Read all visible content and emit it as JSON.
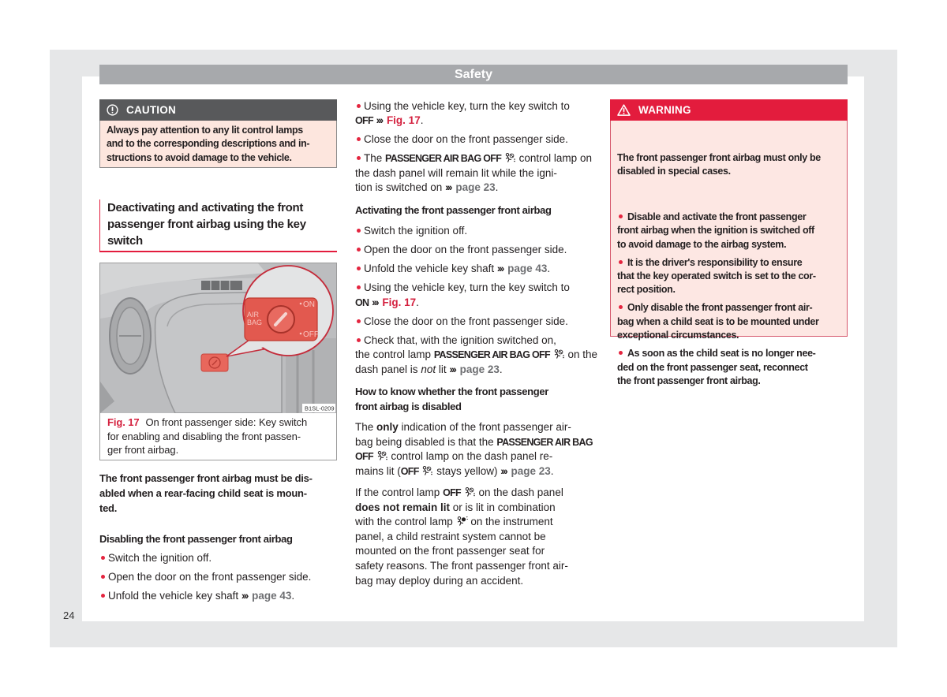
{
  "header": {
    "title": "Safety"
  },
  "page_number": "24",
  "caution": {
    "icon": "exclamation-circle-icon",
    "label": "CAUTION",
    "text": "Always pay attention to any lit control lamps\nand to the corresponding descriptions and in-\nstructions to avoid damage to the vehicle."
  },
  "section_title": "Deactivating and activating the front\npassenger front airbag using the key\nswitch",
  "figure": {
    "labels": {
      "air": "AIR",
      "bag": "BAG",
      "on": "ON",
      "off": "OFF",
      "code": "B1SL-0209"
    },
    "caption_ref": "Fig. 17",
    "caption_text": "On front passenger side: Key switch\nfor enabling and disabling the front passen-\nger front airbag."
  },
  "left_column": {
    "intro_bold": "The front passenger front airbag must be dis-\nabled when a rear-facing child seat is moun-\nted.",
    "disabling_heading": "Disabling the front passenger front airbag",
    "disabling_steps": [
      [
        {
          "t": "Switch the ignition off."
        }
      ],
      [
        {
          "t": "Open the door on the front passenger side."
        }
      ],
      [
        {
          "t": "Unfold the vehicle key shaft "
        },
        {
          "k": "arrow",
          "t": "›››"
        },
        {
          "t": " "
        },
        {
          "k": "link",
          "t": "page 43"
        },
        {
          "t": "."
        }
      ]
    ]
  },
  "middle_column": {
    "disabling_steps_continued": [
      [
        {
          "t": "Using the vehicle key, turn the key switch to\n"
        },
        {
          "k": "cond",
          "t": "OFF"
        },
        {
          "t": " "
        },
        {
          "k": "arrow",
          "t": "›››"
        },
        {
          "t": " "
        },
        {
          "k": "fig",
          "t": "Fig. 17"
        },
        {
          "t": "."
        }
      ],
      [
        {
          "t": "Close the door on the front passenger side."
        }
      ],
      [
        {
          "t": "The "
        },
        {
          "k": "cond",
          "t": "PASSENGER AIR BAG OFF"
        },
        {
          "t": " "
        },
        {
          "k": "icon",
          "t": "airbag-off-icon"
        },
        {
          "t": " control lamp on\nthe dash panel will remain lit while the igni-\ntion is switched on "
        },
        {
          "k": "arrow",
          "t": "›››"
        },
        {
          "t": " "
        },
        {
          "k": "link",
          "t": "page 23"
        },
        {
          "t": "."
        }
      ]
    ],
    "activating_heading": "Activating the front passenger front airbag",
    "activating_steps": [
      [
        {
          "t": "Switch the ignition off."
        }
      ],
      [
        {
          "t": "Open the door on the front passenger side."
        }
      ],
      [
        {
          "t": "Unfold the vehicle key shaft "
        },
        {
          "k": "arrow",
          "t": "›››"
        },
        {
          "t": " "
        },
        {
          "k": "link",
          "t": "page 43"
        },
        {
          "t": "."
        }
      ],
      [
        {
          "t": "Using the vehicle key, turn the key switch to\n"
        },
        {
          "k": "cond",
          "t": "ON"
        },
        {
          "t": " "
        },
        {
          "k": "arrow",
          "t": "›››"
        },
        {
          "t": " "
        },
        {
          "k": "fig",
          "t": "Fig. 17"
        },
        {
          "t": "."
        }
      ],
      [
        {
          "t": "Close the door on the front passenger side."
        }
      ],
      [
        {
          "t": "Check that, with the ignition switched on,\nthe control lamp "
        },
        {
          "k": "cond",
          "t": "PASSENGER AIR BAG OFF"
        },
        {
          "t": " "
        },
        {
          "k": "icon",
          "t": "airbag-off-icon"
        },
        {
          "t": " on the\ndash panel is "
        },
        {
          "k": "i",
          "t": "not"
        },
        {
          "t": " lit "
        },
        {
          "k": "arrow",
          "t": "›››"
        },
        {
          "t": " "
        },
        {
          "k": "link",
          "t": "page 23"
        },
        {
          "t": "."
        }
      ]
    ],
    "howto_heading": "How to know whether the front passenger\nfront airbag is disabled",
    "howto_paragraphs": [
      [
        {
          "t": "The "
        },
        {
          "k": "b",
          "t": "only"
        },
        {
          "t": " indication of the front passenger air-\nbag being disabled is that the "
        },
        {
          "k": "cond",
          "t": "PASSENGER AIR BAG\nOFF"
        },
        {
          "t": " "
        },
        {
          "k": "icon",
          "t": "airbag-off-icon"
        },
        {
          "t": " control lamp on the dash panel re-\nmains lit ("
        },
        {
          "k": "cond",
          "t": "OFF"
        },
        {
          "t": " "
        },
        {
          "k": "icon",
          "t": "airbag-off-icon"
        },
        {
          "t": " stays yellow) "
        },
        {
          "k": "arrow",
          "t": "›››"
        },
        {
          "t": " "
        },
        {
          "k": "link",
          "t": "page 23"
        },
        {
          "t": "."
        }
      ],
      [
        {
          "t": "If the control lamp "
        },
        {
          "k": "cond",
          "t": "OFF"
        },
        {
          "t": " "
        },
        {
          "k": "icon",
          "t": "airbag-off-icon"
        },
        {
          "t": " on the dash panel\n"
        },
        {
          "k": "b",
          "t": "does not remain lit"
        },
        {
          "t": " or is lit in combination\nwith the control lamp "
        },
        {
          "k": "icon",
          "t": "airbag-warning-icon"
        },
        {
          "t": " on the instrument\npanel, a child restraint system cannot be\nmounted on the front passenger seat for\nsafety reasons. The front passenger front air-\nbag may deploy during an accident."
        }
      ]
    ]
  },
  "warning": {
    "icon": "warning-triangle-icon",
    "label": "WARNING",
    "intro": "The front passenger front airbag must only be\ndisabled in special cases.",
    "items": [
      [
        {
          "t": "Disable and activate the front passenger\nfront airbag when the ignition is switched off\nto avoid damage to the airbag system."
        }
      ],
      [
        {
          "t": "It is the driver's responsibility to ensure\nthat the key operated switch is set to the cor-\nrect position."
        }
      ],
      [
        {
          "t": "Only disable the front passenger front air-\nbag when a child seat is to be mounted under\nexceptional circumstances."
        }
      ],
      [
        {
          "t": "As soon as the child seat is no longer nee-\nded on the front passenger seat, reconnect\nthe front passenger front airbag."
        }
      ]
    ]
  },
  "colors": {
    "accent_red": "#e31c3d",
    "caution_header": "#58595b",
    "header_bar": "#a7a9ac",
    "link_gray": "#6d6e71"
  }
}
